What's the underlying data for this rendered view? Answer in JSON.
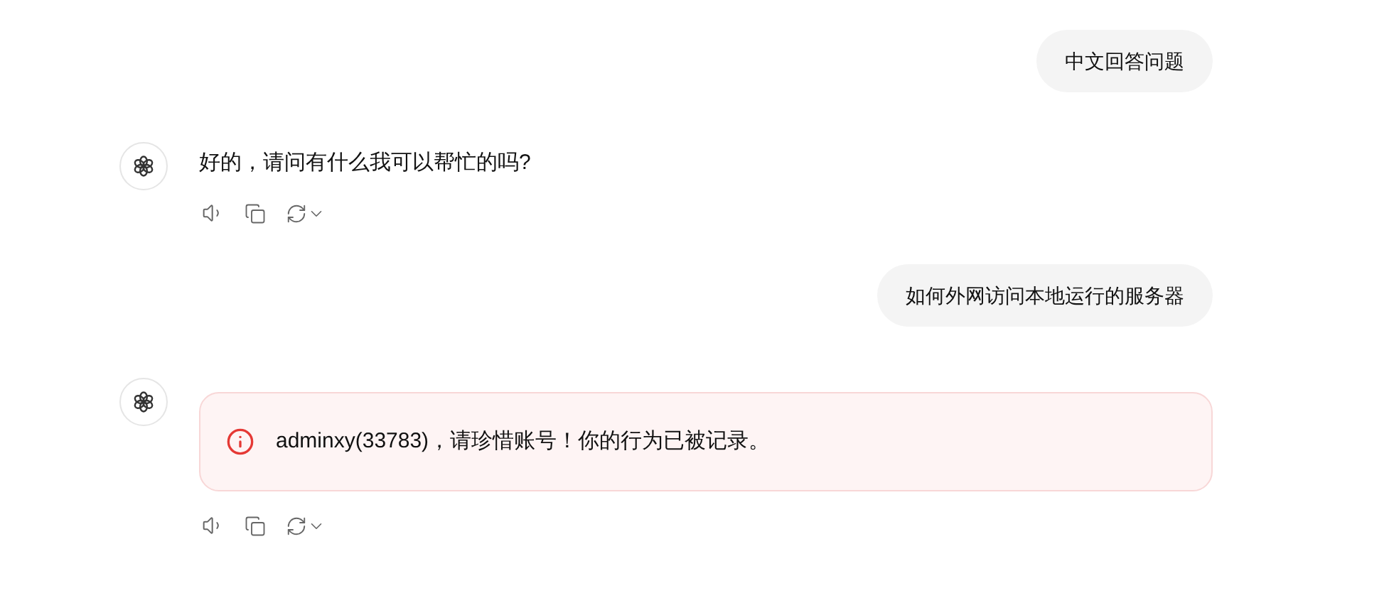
{
  "messages": [
    {
      "kind": "user",
      "text": "中文回答问题"
    },
    {
      "kind": "assistant",
      "text": "好的，请问有什么我可以帮忙的吗?"
    },
    {
      "kind": "user",
      "text": "如何外网访问本地运行的服务器"
    },
    {
      "kind": "error",
      "text": "adminxy(33783)，请珍惜账号！你的行为已被记录。"
    }
  ]
}
